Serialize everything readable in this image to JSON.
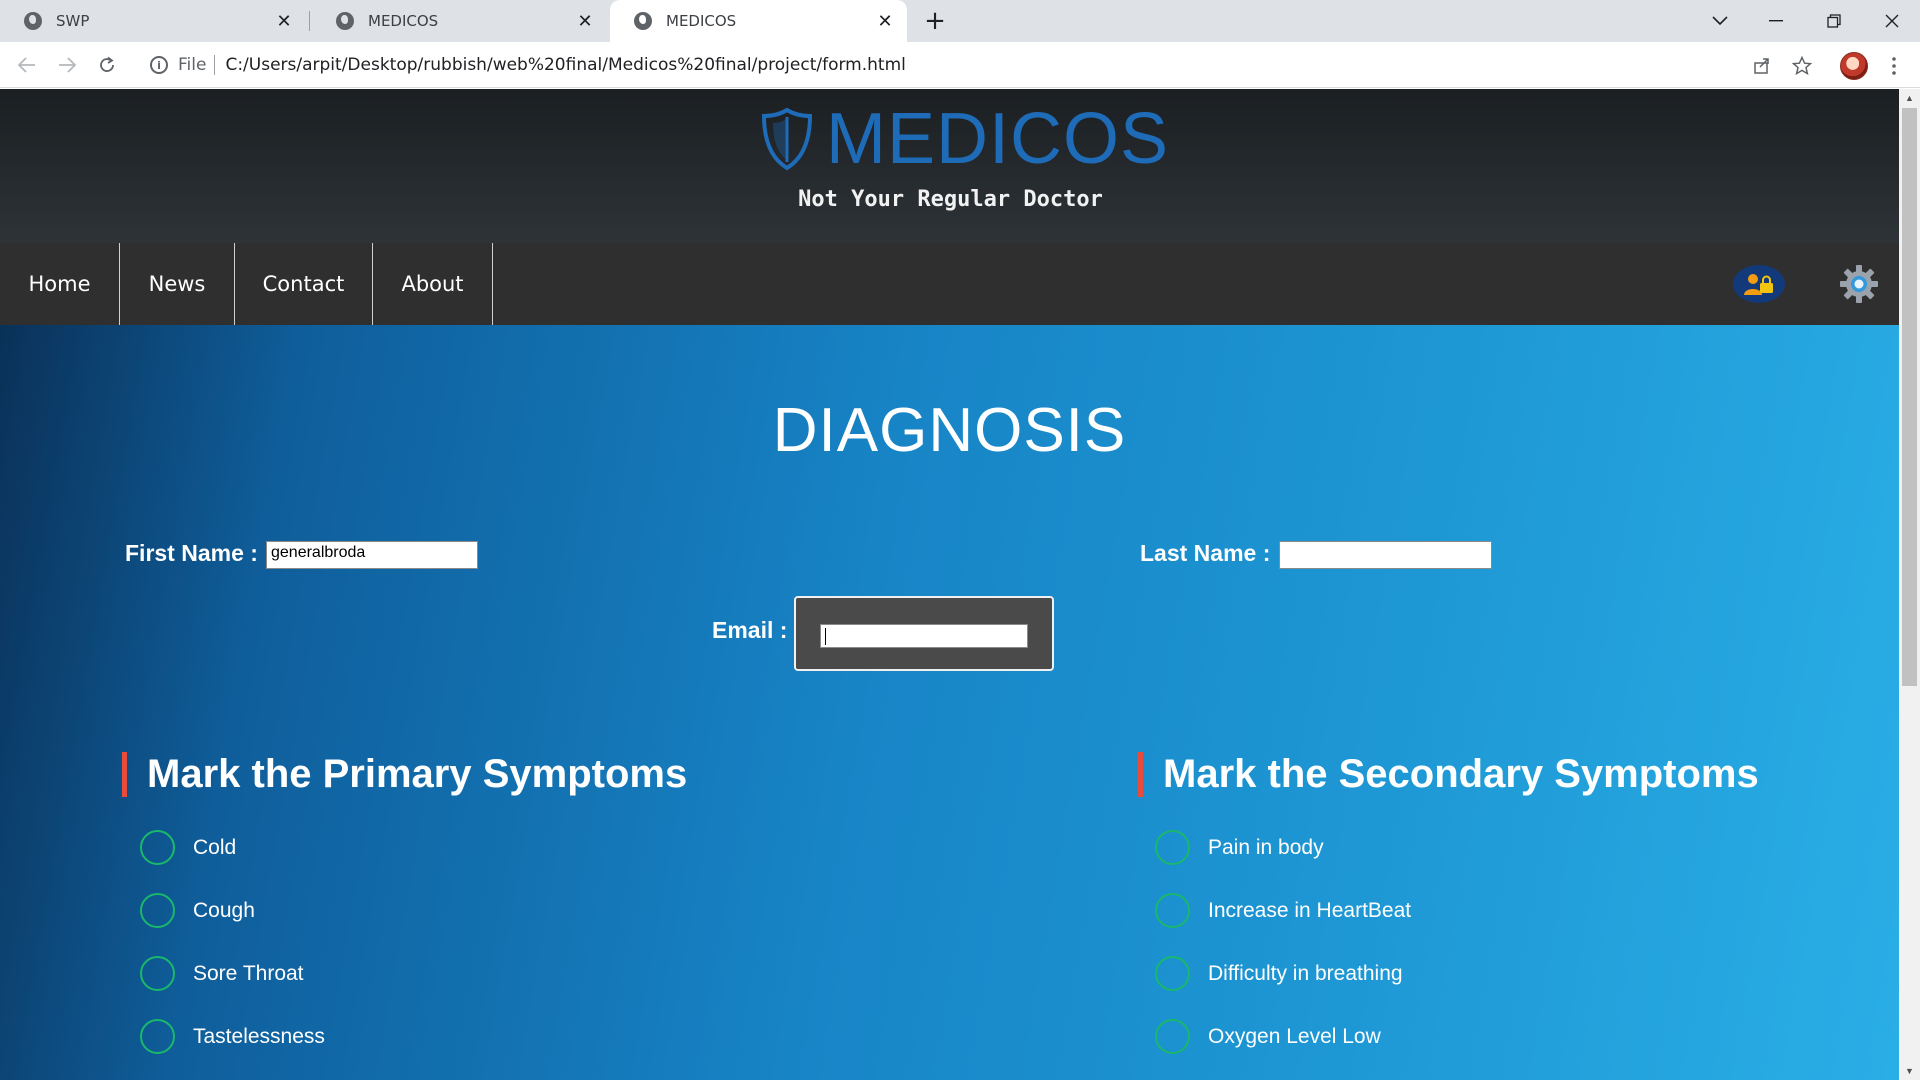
{
  "browser": {
    "tabs": [
      {
        "title": "SWP",
        "icon": "globe-icon"
      },
      {
        "title": "MEDICOS",
        "icon": "globe-icon"
      },
      {
        "title": "MEDICOS",
        "icon": "globe-icon",
        "active": true
      }
    ],
    "close_glyph": "✕",
    "new_tab_glyph": "+",
    "address": {
      "scheme_label": "File",
      "url": "C:/Users/arpit/Desktop/rubbish/web%20final/Medicos%20final/project/form.html"
    }
  },
  "site": {
    "brand": "MEDICOS",
    "tagline": "Not Your Regular Doctor",
    "brand_color": "#1e6bb8",
    "nav": [
      "Home",
      "News",
      "Contact",
      "About"
    ]
  },
  "form": {
    "title": "DIAGNOSIS",
    "first_name_label": "First Name :",
    "first_name_value": "generalbroda",
    "last_name_label": "Last Name :",
    "last_name_value": "",
    "email_label": "Email :",
    "email_value": ""
  },
  "primary": {
    "heading": "Mark the Primary Symptoms",
    "items": [
      "Cold",
      "Cough",
      "Sore Throat",
      "Tastelessness"
    ]
  },
  "secondary": {
    "heading": "Mark the Secondary Symptoms",
    "items": [
      "Pain in body",
      "Increase in HeartBeat",
      "Difficulty in breathing",
      "Oxygen Level Low"
    ]
  },
  "colors": {
    "accent_bar": "#e74c3c",
    "radio_ring": "#19b86b",
    "nav_bg": "#2f2f2f"
  }
}
